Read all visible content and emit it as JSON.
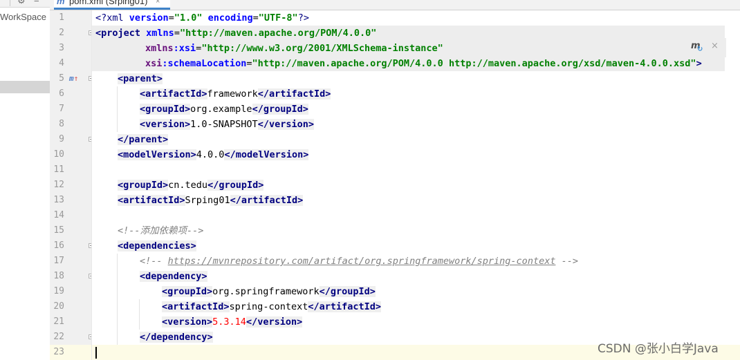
{
  "left_panel": {
    "workspace_label": "WorkSpace",
    "gear_icon": "gear-icon",
    "minus_icon": "minus-icon"
  },
  "tab": {
    "icon": "m",
    "label": "pom.xml (Srping01)",
    "close": "×"
  },
  "maven_popup": {
    "icon": "m",
    "close": "×"
  },
  "gutter": {
    "line_numbers": [
      "1",
      "2",
      "3",
      "4",
      "5",
      "6",
      "7",
      "8",
      "9",
      "10",
      "11",
      "12",
      "13",
      "14",
      "15",
      "16",
      "17",
      "18",
      "19",
      "20",
      "21",
      "22",
      "23"
    ],
    "line5_marker": "m",
    "line5_arrow": "↑"
  },
  "code": {
    "l1": {
      "open": "<?xml ",
      "a1": "version",
      "eq1": "=",
      "v1": "\"1.0\"",
      "sp": " ",
      "a2": "encoding",
      "eq2": "=",
      "v2": "\"UTF-8\"",
      "close": "?>"
    },
    "l2": {
      "open": "<project",
      "sp": " ",
      "a1": "xmlns",
      "eq": "=",
      "v": "\"http://maven.apache.org/POM/4.0.0\""
    },
    "l3": {
      "ns": "xmlns",
      "colon": ":",
      "a": "xsi",
      "eq": "=",
      "v": "\"http://www.w3.org/2001/XMLSchema-instance\""
    },
    "l4": {
      "ns": "xsi",
      "colon": ":",
      "a": "schemaLocation",
      "eq": "=",
      "v": "\"http://maven.apache.org/POM/4.0.0 http://maven.apache.org/xsd/maven-4.0.0.xsd\"",
      "close": ">"
    },
    "l5": {
      "tag": "<parent>"
    },
    "l6": {
      "open": "<artifactId>",
      "text": "framework",
      "close": "</artifactId>"
    },
    "l7": {
      "open": "<groupId>",
      "text": "org.example",
      "close": "</groupId>"
    },
    "l8": {
      "open": "<version>",
      "text": "1.0-SNAPSHOT",
      "close": "</version>"
    },
    "l9": {
      "tag": "</parent>"
    },
    "l10": {
      "open": "<modelVersion>",
      "text": "4.0.0",
      "close": "</modelVersion>"
    },
    "l12": {
      "open": "<groupId>",
      "text": "cn.tedu",
      "close": "</groupId>"
    },
    "l13": {
      "open": "<artifactId>",
      "text": "Srping01",
      "close": "</artifactId>"
    },
    "l15": {
      "comment": "<!--添加依赖项-->"
    },
    "l16": {
      "tag": "<dependencies>"
    },
    "l17": {
      "c_open": "<!-- ",
      "link": "https://mvnrepository.com/artifact/org.springframework/spring-context",
      "c_close": " -->"
    },
    "l18": {
      "tag": "<dependency>"
    },
    "l19": {
      "open": "<groupId>",
      "text": "org.springframework",
      "close": "</groupId>"
    },
    "l20": {
      "open": "<artifactId>",
      "text": "spring-context",
      "close": "</artifactId>"
    },
    "l21": {
      "open": "<version>",
      "text": "5.3.14",
      "close": "</version>"
    },
    "l22": {
      "tag": "</dependency>"
    }
  },
  "watermark": "CSDN @张小白学Java"
}
